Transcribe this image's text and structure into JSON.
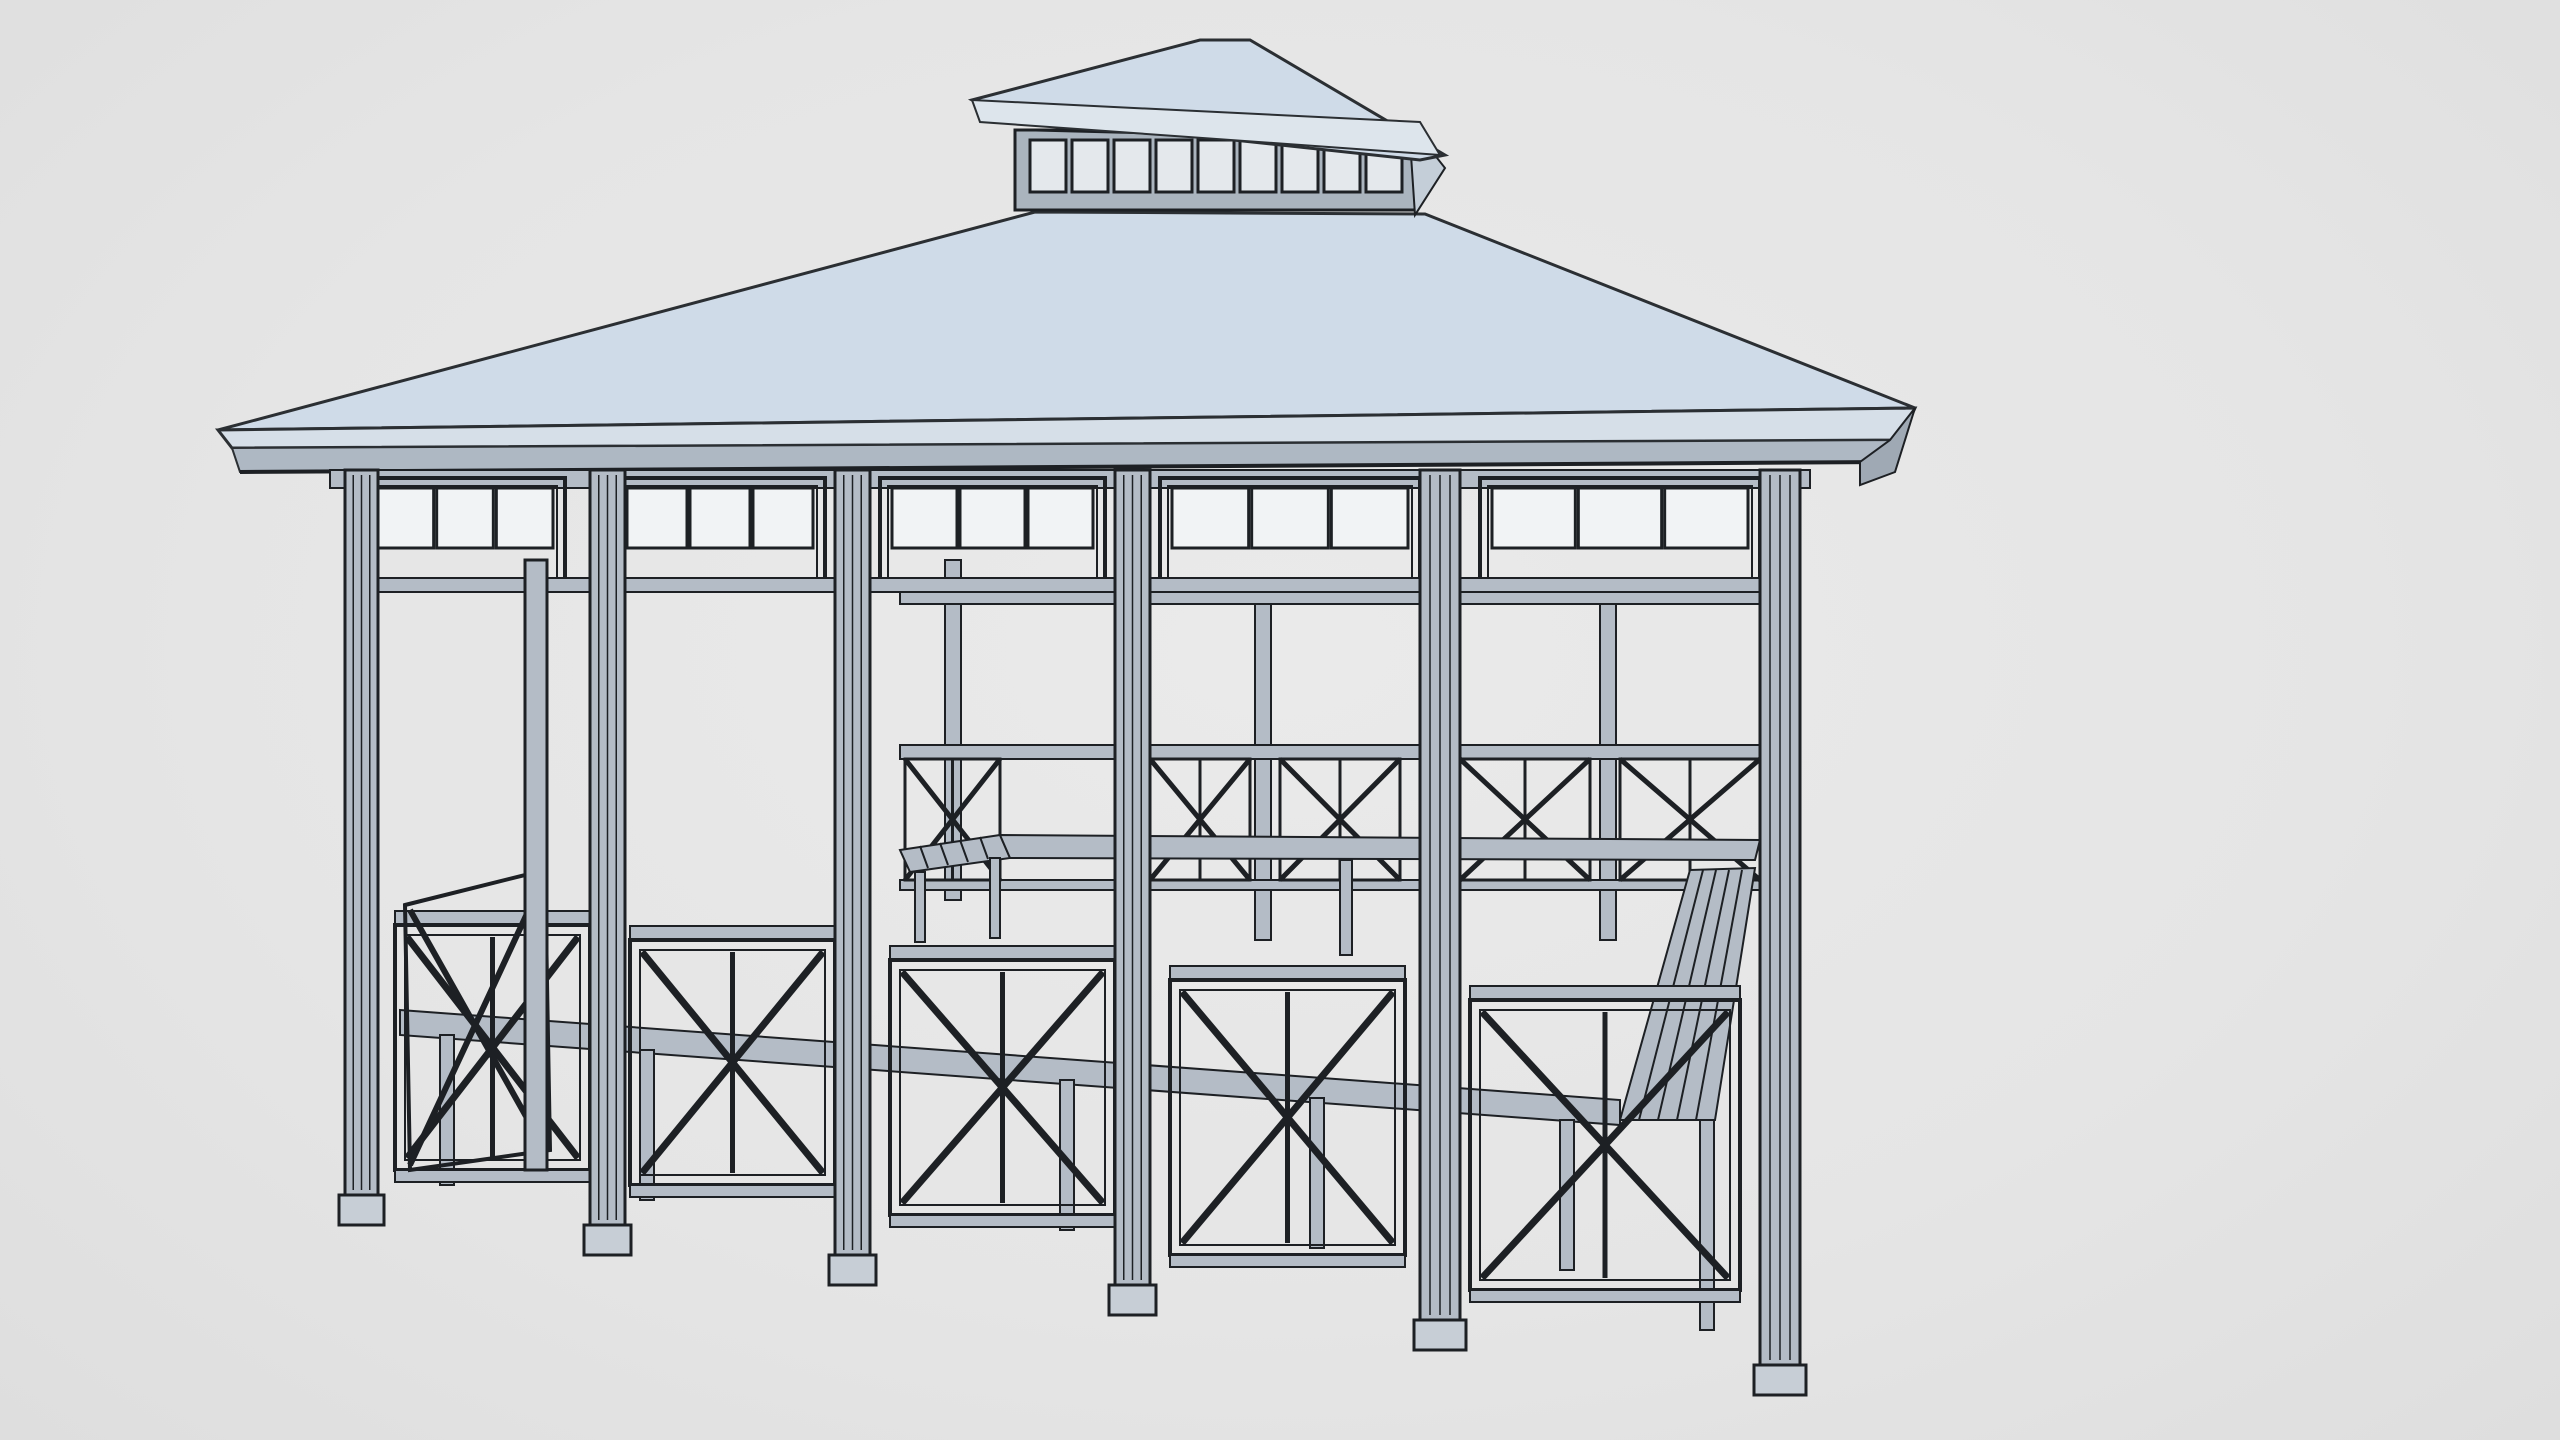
{
  "scene": {
    "subject": "wireframe-gazebo-model",
    "colors": {
      "background": "#e6e6e6",
      "roof_fill": "#cfdbe8",
      "roof_edge": "#2b2f33",
      "structure_fill": "#b4bcc6",
      "outline": "#1d2024"
    }
  }
}
